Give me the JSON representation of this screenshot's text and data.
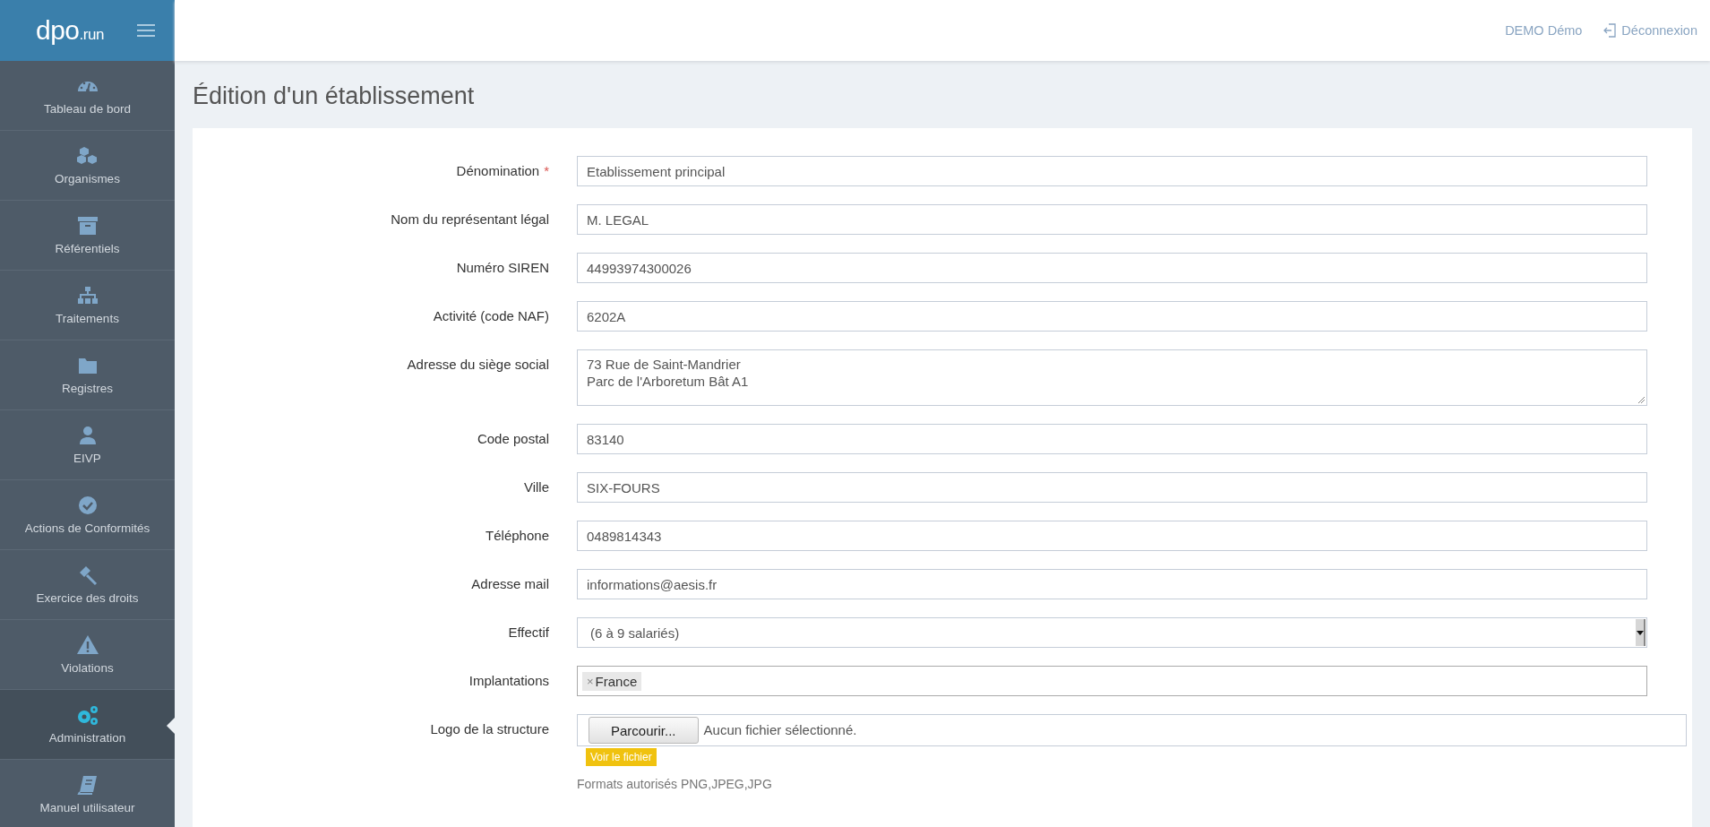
{
  "header": {
    "logo_main": "dpo",
    "logo_suffix": ".run",
    "user": "DEMO Démo",
    "logout": "Déconnexion"
  },
  "sidebar": {
    "items": [
      {
        "label": "Tableau de bord",
        "selected": false
      },
      {
        "label": "Organismes",
        "selected": false
      },
      {
        "label": "Référentiels",
        "selected": false
      },
      {
        "label": "Traitements",
        "selected": false
      },
      {
        "label": "Registres",
        "selected": false
      },
      {
        "label": "EIVP",
        "selected": false
      },
      {
        "label": "Actions de Conformités",
        "selected": false
      },
      {
        "label": "Exercice des droits",
        "selected": false
      },
      {
        "label": "Violations",
        "selected": false
      },
      {
        "label": "Administration",
        "selected": true
      },
      {
        "label": "Manuel utilisateur",
        "selected": false
      }
    ]
  },
  "page_title": "Édition d'un établissement",
  "form": {
    "fields": [
      {
        "kind": "text",
        "label": "Dénomination",
        "required_mark": "*",
        "value": "Etablissement principal"
      },
      {
        "kind": "text",
        "label": "Nom du représentant légal",
        "value": "M. LEGAL"
      },
      {
        "kind": "text",
        "label": "Numéro SIREN",
        "value": "44993974300026"
      },
      {
        "kind": "text",
        "label": "Activité (code NAF)",
        "value": "6202A"
      },
      {
        "kind": "textarea",
        "label": "Adresse du siège social",
        "lines": [
          "73 Rue de Saint-Mandrier",
          "Parc de l'Arboretum Bât A1"
        ]
      },
      {
        "kind": "text",
        "label": "Code postal",
        "value": "83140"
      },
      {
        "kind": "text",
        "label": "Ville",
        "value": "SIX-FOURS"
      },
      {
        "kind": "text",
        "label": "Téléphone",
        "value": "0489814343"
      },
      {
        "kind": "text",
        "label": "Adresse mail",
        "value": "informations@aesis.fr"
      },
      {
        "kind": "select",
        "label": "Effectif",
        "value": "(6 à 9 salariés)"
      },
      {
        "kind": "tags",
        "label": "Implantations",
        "tags": [
          {
            "remove": "×",
            "label": "France"
          }
        ]
      },
      {
        "kind": "file",
        "label": "Logo de la structure",
        "button": "Parcourir...",
        "status": "Aucun fichier sélectionné.",
        "link": "Voir le fichier",
        "help": "Formats autorisés PNG,JPEG,JPG"
      }
    ]
  }
}
